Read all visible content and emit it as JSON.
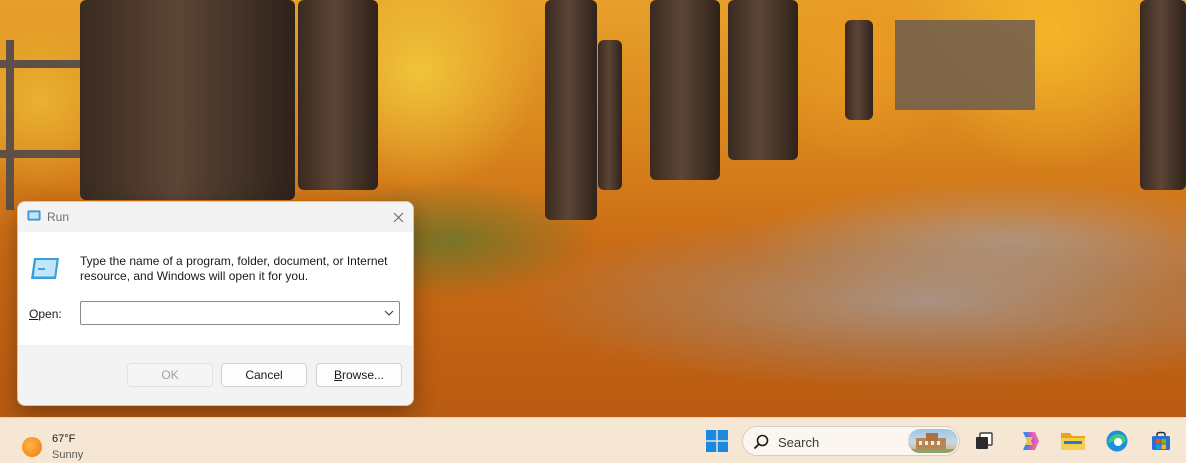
{
  "run_dialog": {
    "title": "Run",
    "description": "Type the name of a program, folder, document, or Internet resource, and Windows will open it for you.",
    "open_label_accel": "O",
    "open_label_rest": "pen:",
    "command_value": "",
    "ok_label": "OK",
    "cancel_label": "Cancel",
    "browse_label_accel": "B",
    "browse_label_rest": "rowse..."
  },
  "taskbar": {
    "weather": {
      "temperature": "67°F",
      "condition": "Sunny"
    },
    "search": {
      "label": "Search"
    },
    "pinned": [
      "start-icon",
      "task-view-icon",
      "copilot-icon",
      "file-explorer-icon",
      "edge-icon",
      "microsoft-store-icon"
    ]
  },
  "colors": {
    "accent": "#0078d4",
    "taskbar_bg": "#f6e7d5",
    "dialog_bg": "#f3f3f3"
  }
}
